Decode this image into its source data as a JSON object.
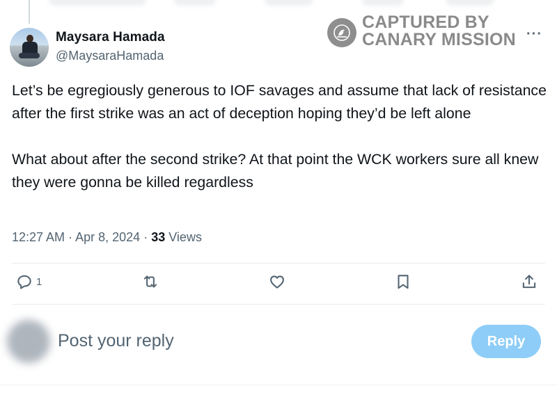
{
  "watermark": {
    "line1": "CAPTURED BY",
    "line2": "CANARY MISSION"
  },
  "author": {
    "name": "Maysara Hamada",
    "handle": "@MaysaraHamada"
  },
  "menu": {
    "more_icon": "more-horizontal-icon"
  },
  "tweet": {
    "paragraphs": [
      "Let’s be egregiously generous to IOF savages and assume that lack of resistance after the first strike was an act of deception hoping they’d be left alone",
      "What about after the second strike? At that point the WCK workers sure all knew they were gonna be killed regardless"
    ],
    "time": "12:27 AM",
    "date": "Apr 8, 2024",
    "separator": "·",
    "views_count": "33",
    "views_label": "Views"
  },
  "actions": {
    "reply": {
      "icon": "reply-icon",
      "count": "1"
    },
    "retweet": {
      "icon": "retweet-icon"
    },
    "like": {
      "icon": "heart-icon"
    },
    "bookmark": {
      "icon": "bookmark-icon"
    },
    "share": {
      "icon": "share-icon"
    }
  },
  "composer": {
    "placeholder": "Post your reply",
    "button_label": "Reply",
    "button_color": "#8ecdf7"
  },
  "colors": {
    "text": "#0f1419",
    "secondary": "#536471",
    "watermark": "#8a8a8a"
  }
}
